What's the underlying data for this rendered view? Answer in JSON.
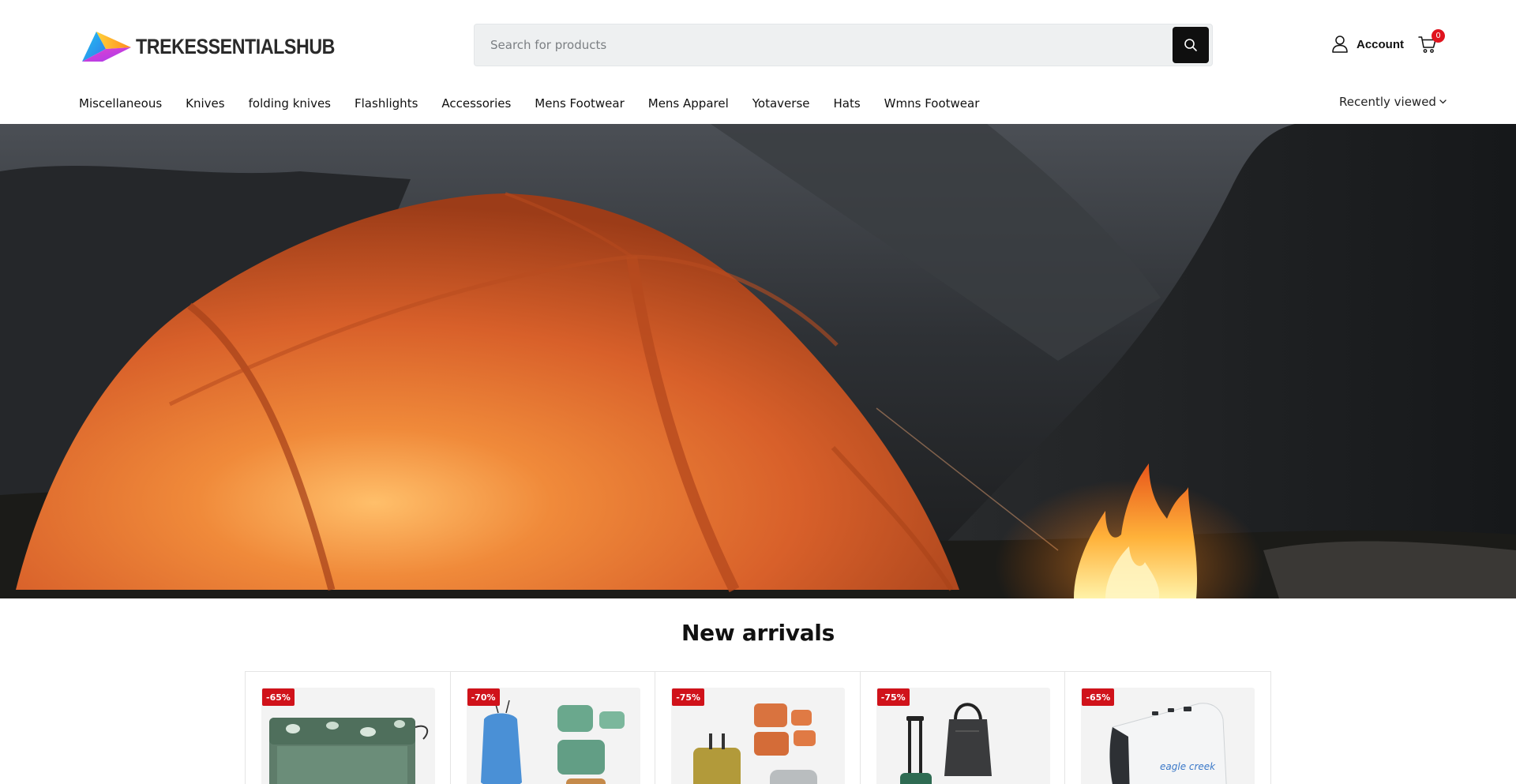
{
  "brand": {
    "name": "TREKESSENTIALSHUB"
  },
  "search": {
    "placeholder": "Search for products"
  },
  "header": {
    "account_label": "Account",
    "cart_count": "0",
    "recently_viewed": "Recently viewed"
  },
  "nav": {
    "items": [
      {
        "label": "Miscellaneous"
      },
      {
        "label": "Knives"
      },
      {
        "label": "folding knives"
      },
      {
        "label": "Flashlights"
      },
      {
        "label": "Accessories"
      },
      {
        "label": "Mens Footwear"
      },
      {
        "label": "Mens Apparel"
      },
      {
        "label": "Yotaverse"
      },
      {
        "label": "Hats"
      },
      {
        "label": "Wmns Footwear"
      }
    ]
  },
  "new_arrivals": {
    "title": "New arrivals",
    "products": [
      {
        "discount": "-65%",
        "image_icon": "pouch-image"
      },
      {
        "discount": "-70%",
        "image_icon": "packing-cubes-image"
      },
      {
        "discount": "-75%",
        "image_icon": "luggage-set-image"
      },
      {
        "discount": "-75%",
        "image_icon": "tote-roller-image"
      },
      {
        "discount": "-65%",
        "image_icon": "travel-adapter-image"
      }
    ],
    "adapter_print": "eagle creek"
  },
  "colors": {
    "badge": "#d0121a",
    "cart_badge": "#e0141e",
    "search_bg": "#eef0f1",
    "search_button": "#0f0f0f",
    "tent": "#e0652a"
  }
}
